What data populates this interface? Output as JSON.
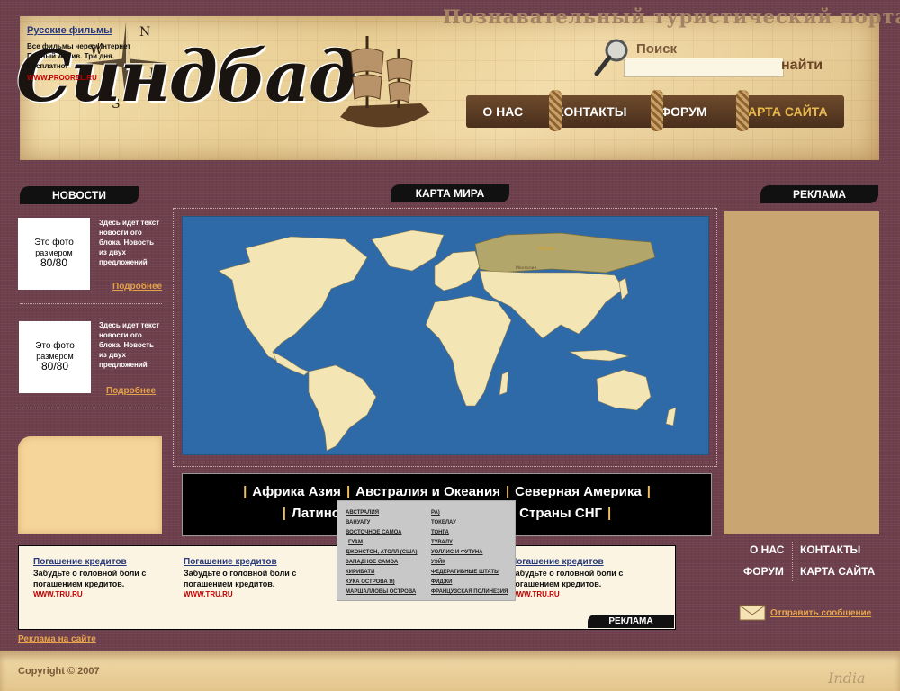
{
  "header": {
    "logo": "Синдбад",
    "portal_title": "Познавательный туристический портал",
    "compass": {
      "n": "N",
      "s": "S",
      "w": "W",
      "e": "E"
    },
    "search_label": "Поиск",
    "search_value": "",
    "search_button": "найти",
    "nav": [
      "О НАС",
      "КОНТАКТЫ",
      "ФОРУМ",
      "КАРТА САЙТА"
    ]
  },
  "news": {
    "tab": "НОВОСТИ",
    "items": [
      {
        "photo_l1": "Это фото",
        "photo_l2": "размером",
        "photo_l3": "80/80",
        "text": "Здесь идет текст новости ого блока. Новость из двух предложений",
        "more": "Подробнее"
      },
      {
        "photo_l1": "Это фото",
        "photo_l2": "размером",
        "photo_l3": "80/80",
        "text": "Здесь идет текст новости ого блока. Новость из двух предложений",
        "more": "Подробнее"
      }
    ]
  },
  "films": {
    "title": "Русские фильмы",
    "text": "Все фильмы через Интернет Полный Архив. Три дня. Бесплатно!",
    "url": "WWW.PROOREL.RU"
  },
  "map": {
    "tab": "КАРТА МИРА",
    "labels": {
      "russia": "Россия",
      "mongolia": "Монголия"
    },
    "colors": {
      "ocean": "#2f6aa8",
      "land": "#f3e6b4",
      "highlight": "#b3a66a"
    }
  },
  "regions": {
    "row1": [
      "Африка",
      "Азия",
      "Австралия и Океания",
      "Северная Америка"
    ],
    "row2": [
      "Латинс",
      "Страны СНГ"
    ]
  },
  "dropdown": {
    "col1": [
      "АВСТРАЛИЯ",
      "ВАНУАТУ",
      "ВОСТОЧНОЕ САМОА",
      "ГУАМ",
      "ДЖОНСТОН, АТОЛЛ (США)",
      "ЗАПАДНОЕ САМОА",
      "КИРИБАТИ",
      "КУКА ОСТРОВА Я)",
      "МАРШАЛЛОВЫ ОСТРОВА"
    ],
    "col2": [
      "РА)",
      "ТОКЕЛАУ",
      "ТОНГА",
      "ТУВАЛУ",
      "УОЛЛИС И ФУТУНА",
      "УЭЙК",
      "ФЕДЕРАТИВНЫЕ ШТАТЫ",
      "ФИДЖИ",
      "ФРАНЦУЗСКАЯ ПОЛИНЕЗИЯ"
    ]
  },
  "ads": {
    "tab": "РЕКЛАМА",
    "strip_tab": "РЕКЛАМА",
    "credits": [
      {
        "title": "Погашение кредитов",
        "text": "Забудьте о головной боли с погашением кредитов.",
        "url": "WWW.TRU.RU"
      },
      {
        "title": "Погашение кредитов",
        "text": "Забудьте о головной боли с погашением кредитов.",
        "url": "WWW.TRU.RU"
      },
      {
        "title": "Погашение кредитов",
        "text": "Забудьте о головной боли с погашением кредитов.",
        "url": "WWW.TRU.RU"
      }
    ],
    "site_ads": "Реклама на сайте"
  },
  "footer_nav": {
    "about": "О НАС",
    "contacts": "КОНТАКТЫ",
    "forum": "ФОРУМ",
    "sitemap": "КАРТА САЙТА",
    "send_message": "Отправить сообщение"
  },
  "footer": {
    "copyright": "Copyright © 2007",
    "decor": "India"
  }
}
